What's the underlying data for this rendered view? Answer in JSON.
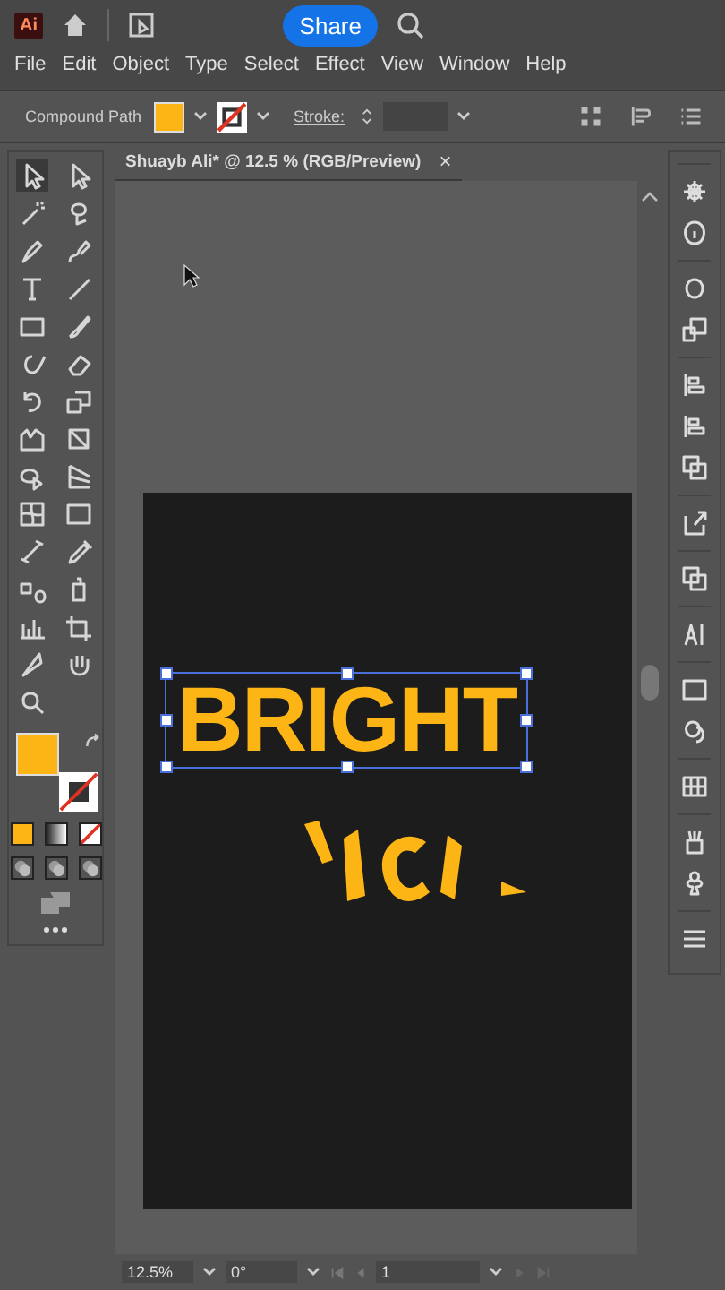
{
  "window": {
    "app_badge": "Ai",
    "share": "Share"
  },
  "menu": [
    "File",
    "Edit",
    "Object",
    "Type",
    "Select",
    "Effect",
    "View",
    "Window",
    "Help"
  ],
  "control_bar": {
    "selection": "Compound Path",
    "stroke_label": "Stroke:"
  },
  "document_tab": {
    "title": "Shuayb Ali* @ 12.5 % (RGB/Preview)",
    "close": "×"
  },
  "artboard": {
    "text": "BRIGHT",
    "selected": true
  },
  "status_bar": {
    "zoom": "12.5%",
    "rotation": "0°",
    "artboard": "1"
  }
}
